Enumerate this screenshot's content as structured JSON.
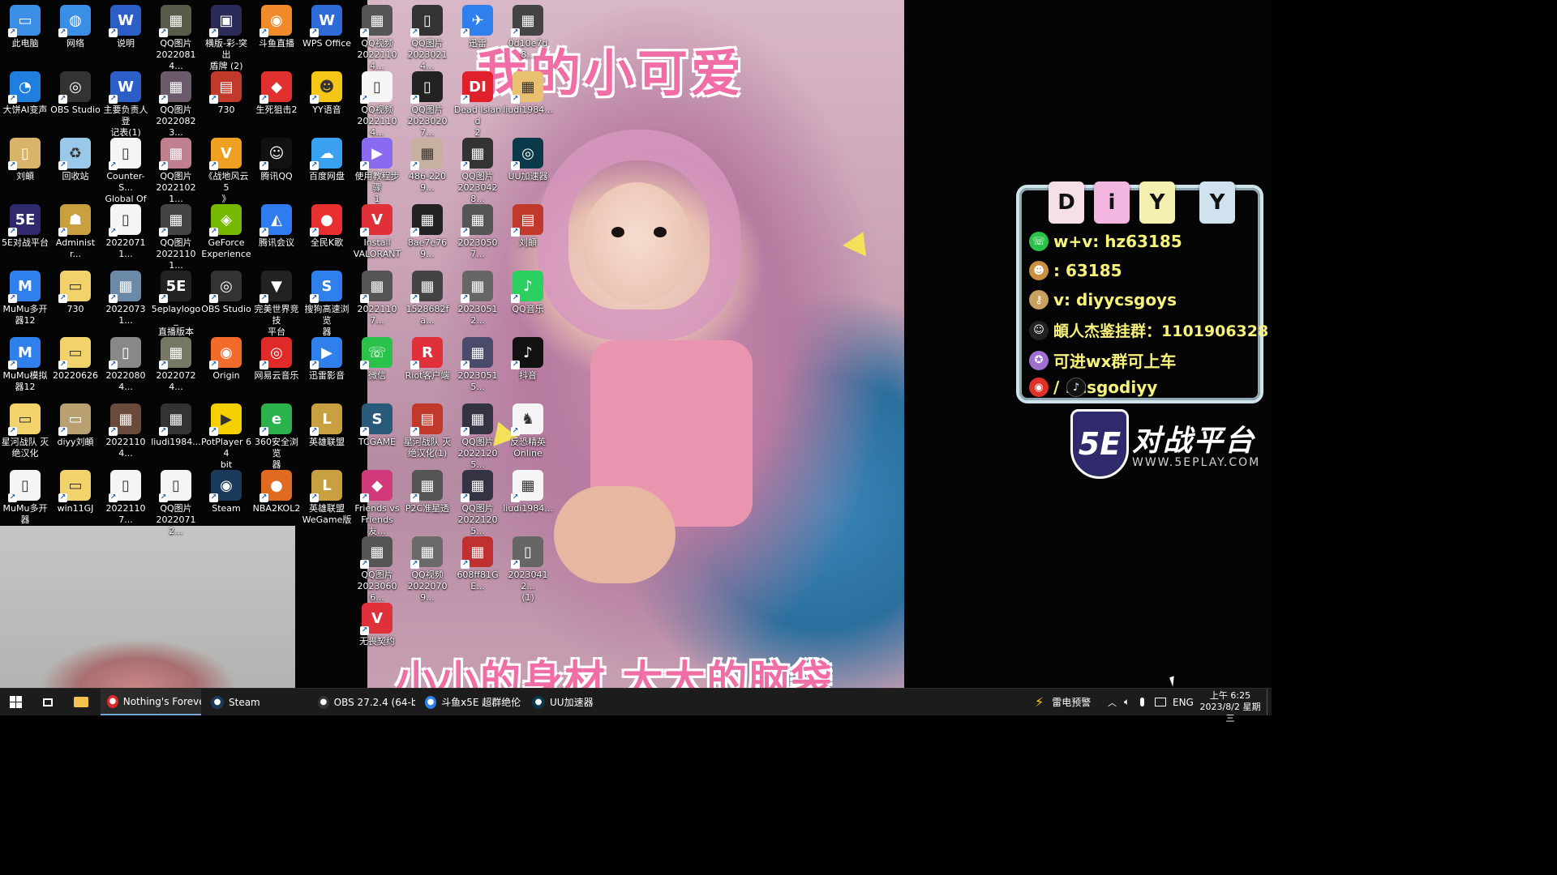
{
  "wallpaper": {
    "title": "我的小可爱",
    "subtitle": "小小的身材 大大的脑袋"
  },
  "desktop_icons": [
    {
      "label": "此电脑",
      "color": "#3a8ee6",
      "glyph": "▭"
    },
    {
      "label": "网络",
      "color": "#3a8ee6",
      "glyph": "◍"
    },
    {
      "label": "说明",
      "color": "#2b5fc7",
      "glyph": "W"
    },
    {
      "label": "QQ图片\n20220814...",
      "color": "#5a5a4a",
      "glyph": "▦"
    },
    {
      "label": "横版-彩-突出\n盾牌 (2)",
      "color": "#2b2b5a",
      "glyph": "▣"
    },
    {
      "label": "斗鱼直播",
      "color": "#f08a2a",
      "glyph": "◉"
    },
    {
      "label": "WPS Office",
      "color": "#2f6bd8",
      "glyph": "W"
    },
    {
      "label": "大饼AI变声",
      "color": "#1e7fe0",
      "glyph": "◔"
    },
    {
      "label": "OBS Studio",
      "color": "#333333",
      "glyph": "◎"
    },
    {
      "label": "主要负责人登\n记表(1)",
      "color": "#2b5fc7",
      "glyph": "W"
    },
    {
      "label": "QQ图片\n20220823...",
      "color": "#6a5a6a",
      "glyph": "▦"
    },
    {
      "label": "730",
      "color": "#c0392b",
      "glyph": "▤"
    },
    {
      "label": "生死狙击2",
      "color": "#e03030",
      "glyph": "◆"
    },
    {
      "label": "YY语音",
      "color": "#f5c518",
      "glyph": "☻"
    },
    {
      "label": "刘頔",
      "color": "#d8b36a",
      "glyph": "▯"
    },
    {
      "label": "回收站",
      "color": "#9ac8e8",
      "glyph": "♻"
    },
    {
      "label": "Counter-S...\nGlobal Off...",
      "color": "#f5f5f5",
      "glyph": "▯"
    },
    {
      "label": "QQ图片\n20221021...",
      "color": "#c08090",
      "glyph": "▦"
    },
    {
      "label": "《战地风云 5\n》",
      "color": "#f0a020",
      "glyph": "V"
    },
    {
      "label": "腾讯QQ",
      "color": "#111111",
      "glyph": "☺"
    },
    {
      "label": "百度网盘",
      "color": "#3aa0f0",
      "glyph": "☁"
    },
    {
      "label": "5E对战平台",
      "color": "#2e2a6b",
      "glyph": "5E"
    },
    {
      "label": "Administr...",
      "color": "#c8a040",
      "glyph": "☗"
    },
    {
      "label": "20220711...",
      "color": "#f5f5f5",
      "glyph": "▯"
    },
    {
      "label": "QQ图片\n20221101...",
      "color": "#444444",
      "glyph": "▦"
    },
    {
      "label": "GeForce\nExperience",
      "color": "#76b900",
      "glyph": "◈"
    },
    {
      "label": "腾讯会议",
      "color": "#2f7bf0",
      "glyph": "◭"
    },
    {
      "label": "全民K歌",
      "color": "#e83030",
      "glyph": "●"
    },
    {
      "label": "MuMu多开\n器12",
      "color": "#2f80ed",
      "glyph": "M"
    },
    {
      "label": "730",
      "color": "#f2d36b",
      "glyph": "▭"
    },
    {
      "label": "20220731...",
      "color": "#6a8aa8",
      "glyph": "▦"
    },
    {
      "label": "5eplaylogo_\n直播版本",
      "color": "#222222",
      "glyph": "5E"
    },
    {
      "label": "OBS Studio",
      "color": "#333333",
      "glyph": "◎"
    },
    {
      "label": "完美世界竞技\n平台",
      "color": "#222222",
      "glyph": "▼"
    },
    {
      "label": "搜狗高速浏览\n器",
      "color": "#2f80ed",
      "glyph": "S"
    },
    {
      "label": "MuMu模拟\n器12",
      "color": "#2f80ed",
      "glyph": "M"
    },
    {
      "label": "20220626",
      "color": "#f2d36b",
      "glyph": "▭"
    },
    {
      "label": "20220804...",
      "color": "#888888",
      "glyph": "▯"
    },
    {
      "label": "20220724...",
      "color": "#777766",
      "glyph": "▦"
    },
    {
      "label": "Origin",
      "color": "#f26b2a",
      "glyph": "◉"
    },
    {
      "label": "网易云音乐",
      "color": "#e02a2a",
      "glyph": "◎"
    },
    {
      "label": "迅雷影音",
      "color": "#2f80ed",
      "glyph": "▶"
    },
    {
      "label": "星河战队 灭\n绝汉化",
      "color": "#f2d36b",
      "glyph": "▭"
    },
    {
      "label": "diyy刘頔",
      "color": "#b8a070",
      "glyph": "▭"
    },
    {
      "label": "20221104...",
      "color": "#6a4a3a",
      "glyph": "▦"
    },
    {
      "label": "liudi1984...",
      "color": "#333333",
      "glyph": "▦"
    },
    {
      "label": "PotPlayer 64\nbit",
      "color": "#f5d000",
      "glyph": "▶"
    },
    {
      "label": "360安全浏览\n器",
      "color": "#2bb24c",
      "glyph": "e"
    },
    {
      "label": "英雄联盟",
      "color": "#c8a040",
      "glyph": "L"
    },
    {
      "label": "MuMu多开\n器",
      "color": "#f5f5f5",
      "glyph": "▯"
    },
    {
      "label": "win11GJ",
      "color": "#f2d36b",
      "glyph": "▭"
    },
    {
      "label": "20221107...",
      "color": "#f5f5f5",
      "glyph": "▯"
    },
    {
      "label": "QQ图片\n20220712...",
      "color": "#f5f5f5",
      "glyph": "▯"
    },
    {
      "label": "Steam",
      "color": "#1b3a5a",
      "glyph": "◉"
    },
    {
      "label": "NBA2KOL2",
      "color": "#e06a20",
      "glyph": "●"
    },
    {
      "label": "英雄联盟\nWeGame版",
      "color": "#c8a040",
      "glyph": "L"
    }
  ],
  "desktop_icons_2": [
    {
      "label": "QQ视频\n20221104...",
      "color": "#555555",
      "glyph": "▦"
    },
    {
      "label": "QQ图片\n20230214...",
      "color": "#333333",
      "glyph": "▯"
    },
    {
      "label": "迅雷",
      "color": "#2f80ed",
      "glyph": "✈"
    },
    {
      "label": "0d10e7d8...",
      "color": "#444444",
      "glyph": "▦"
    },
    {
      "label": "QQ视频\n20221104...",
      "color": "#f5f5f5",
      "glyph": "▯"
    },
    {
      "label": "QQ图片\n20230207...",
      "color": "#222222",
      "glyph": "▯"
    },
    {
      "label": "Dead Island\n2",
      "color": "#e0202a",
      "glyph": "DI"
    },
    {
      "label": "liudi1984...",
      "color": "#e8c070",
      "glyph": "▦"
    },
    {
      "label": "使用教程步骤\n1",
      "color": "#8a6af0",
      "glyph": "▶"
    },
    {
      "label": "486-2209...",
      "color": "#c8b0a0",
      "glyph": "▦"
    },
    {
      "label": "QQ图片\n20230428...",
      "color": "#333333",
      "glyph": "▦"
    },
    {
      "label": "UU加速器",
      "color": "#0a3a4a",
      "glyph": "◎"
    },
    {
      "label": "Install\nVALORANT",
      "color": "#e0303a",
      "glyph": "V"
    },
    {
      "label": "8ae7e769...",
      "color": "#222222",
      "glyph": "▦"
    },
    {
      "label": "20230507...",
      "color": "#555555",
      "glyph": "▦"
    },
    {
      "label": "刘頔",
      "color": "#c0392b",
      "glyph": "▤"
    },
    {
      "label": "20221107...",
      "color": "#555555",
      "glyph": "▦"
    },
    {
      "label": "1528682fa...",
      "color": "#444444",
      "glyph": "▦"
    },
    {
      "label": "20230512...",
      "color": "#666666",
      "glyph": "▦"
    },
    {
      "label": "QQ音乐",
      "color": "#2bd060",
      "glyph": "♪"
    },
    {
      "label": "微信",
      "color": "#2bc24c",
      "glyph": "☏"
    },
    {
      "label": "Riot客户端",
      "color": "#e0303a",
      "glyph": "R"
    },
    {
      "label": "20230515...",
      "color": "#4a4a6a",
      "glyph": "▦"
    },
    {
      "label": "抖音",
      "color": "#111111",
      "glyph": "♪"
    },
    {
      "label": "TCGAME",
      "color": "#2a5a7a",
      "glyph": "S"
    },
    {
      "label": "星河战队 灭\n绝汉化(1)",
      "color": "#c0392b",
      "glyph": "▤"
    },
    {
      "label": "QQ图片\n20221205...",
      "color": "#333344",
      "glyph": "▦"
    },
    {
      "label": "反恐精英\nOnline",
      "color": "#f5f5f5",
      "glyph": "♞"
    },
    {
      "label": "Friends vs\nFriends 友...",
      "color": "#d03a7a",
      "glyph": "◆"
    },
    {
      "label": "P2C准星透",
      "color": "#555555",
      "glyph": "▦"
    },
    {
      "label": "QQ图片\n20221205...",
      "color": "#333344",
      "glyph": "▦"
    },
    {
      "label": "liudi1984...",
      "color": "#f5f5f5",
      "glyph": "▦"
    },
    {
      "label": "QQ图片\n20230606...",
      "color": "#555555",
      "glyph": "▦"
    },
    {
      "label": "QQ视频\n20220709...",
      "color": "#6a6a6a",
      "glyph": "▦"
    },
    {
      "label": "608ff81GE...",
      "color": "#c03030",
      "glyph": "▦"
    },
    {
      "label": "20230412...\n(1)",
      "color": "#666666",
      "glyph": "▯"
    },
    {
      "label": "无畏契约",
      "color": "#e0303a",
      "glyph": "V"
    }
  ],
  "panel": {
    "tags": [
      "D",
      "i",
      "Y",
      "Y"
    ],
    "rows": [
      {
        "icon": "wechat-icon",
        "text": "w+v:  hz63185"
      },
      {
        "icon": "raccoon-icon",
        "text": ": 63185"
      },
      {
        "icon": "key-icon",
        "text": "v:  diyycsgoys"
      },
      {
        "icon": "qq-penguin-icon",
        "text": "頔人杰鉴挂群：1101906328"
      },
      {
        "icon": "badge-icon",
        "text": "可进wx群可上车"
      },
      {
        "icon": "weibo-tiktok-icon",
        "text": "/    :  csgodiyy"
      }
    ]
  },
  "brand": {
    "logo": "5E",
    "name": "对战平台",
    "url": "WWW.5EPLAY.COM"
  },
  "taskbar": {
    "apps": [
      {
        "label": "Nothing's Foreve...",
        "color": "#e02a2a",
        "active": true
      },
      {
        "label": "Steam",
        "color": "#1b3a5a",
        "active": false
      },
      {
        "label": "OBS 27.2.4 (64-bi...",
        "color": "#333333",
        "active": false
      },
      {
        "label": "斗鱼x5E 超群绝伦 ...",
        "color": "#2f80ed",
        "active": false
      },
      {
        "label": "UU加速器",
        "color": "#0a3a4a",
        "active": false
      }
    ],
    "weather": "雷电预警",
    "lang": "ENG",
    "time": "上午 6:25",
    "date": "2023/8/2 星期三"
  }
}
